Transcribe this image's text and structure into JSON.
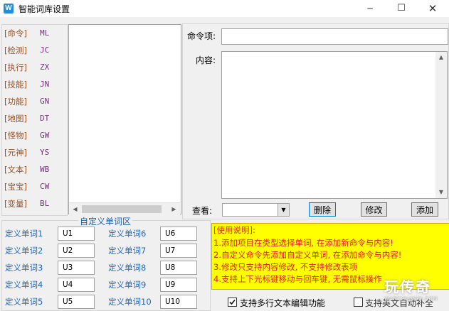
{
  "window": {
    "title": "智能词库设置",
    "app_icon_letter": "W",
    "minimize_glyph": "─",
    "maximize_glyph": "☐",
    "close_glyph": "✕"
  },
  "categories": [
    {
      "label": "[命令]",
      "code": "ML"
    },
    {
      "label": "[检测]",
      "code": "JC"
    },
    {
      "label": "[执行]",
      "code": "ZX"
    },
    {
      "label": "[技能]",
      "code": "JN"
    },
    {
      "label": "[功能]",
      "code": "GN"
    },
    {
      "label": "[地图]",
      "code": "DT"
    },
    {
      "label": "[怪物]",
      "code": "GW"
    },
    {
      "label": "[元神]",
      "code": "YS"
    },
    {
      "label": "[文本]",
      "code": "WB"
    },
    {
      "label": "[宝宝]",
      "code": "CW"
    },
    {
      "label": "[变量]",
      "code": "BL"
    }
  ],
  "form": {
    "command_label": "命令项:",
    "command_value": "",
    "content_label": "内容:",
    "content_value": "",
    "view_label": "查看:",
    "view_selected": ""
  },
  "buttons": {
    "delete": "删除",
    "modify": "修改",
    "add": "添加"
  },
  "custom_words": {
    "legend": "自定义单词区",
    "left": [
      {
        "label": "定义单词1",
        "value": "U1"
      },
      {
        "label": "定义单词2",
        "value": "U2"
      },
      {
        "label": "定义单词3",
        "value": "U3"
      },
      {
        "label": "定义单词4",
        "value": "U4"
      },
      {
        "label": "定义单词5",
        "value": "U5"
      }
    ],
    "right": [
      {
        "label": "定义单词6",
        "value": "U6"
      },
      {
        "label": "定义单词7",
        "value": "U7"
      },
      {
        "label": "定义单词8",
        "value": "U8"
      },
      {
        "label": "定义单词9",
        "value": "U9"
      },
      {
        "label": "定义单词10",
        "value": "U10"
      }
    ]
  },
  "usage": {
    "title": "[使用说明]:",
    "lines": [
      "1.添加项目在类型选择单词, 在添加新命令与内容!",
      "2.自定义命令先添加自定义单词, 在添加命令与内容!",
      "3.修改只支持内容修改, 不支持修改表项",
      "4.支持上下光标键移动与回车键, 无需鼠标操作"
    ]
  },
  "options": {
    "multiline_label": "支持多行文本编辑功能",
    "multiline_checked": true,
    "second_label": "支持英文自动补全",
    "second_checked": false
  },
  "watermark": {
    "brand": "玩传奇",
    "url": "WANCHUANQI.COM"
  },
  "colors": {
    "category_label": "#9a4e23",
    "category_code": "#7a2d82",
    "custom_label": "#1f66c4",
    "usage_bg": "#ffff00",
    "usage_text": "#e02020"
  }
}
